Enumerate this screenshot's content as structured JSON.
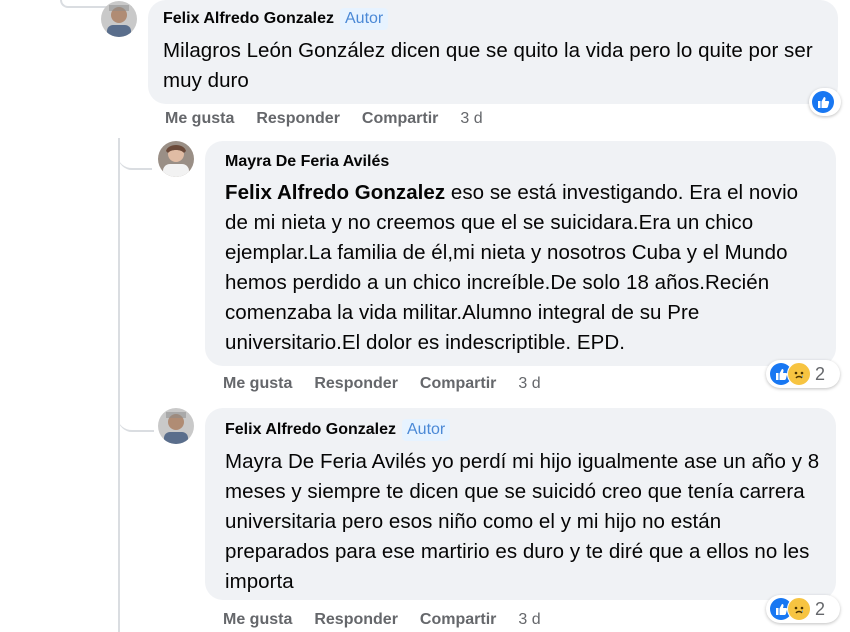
{
  "comments": [
    {
      "author": "Felix Alfredo Gonzalez",
      "badge": "Autor",
      "text": "Milagros León González dicen que se quito la vida pero lo quite por ser muy duro",
      "actions": {
        "like": "Me gusta",
        "reply": "Responder",
        "share": "Compartir",
        "time": "3 d"
      },
      "reactions": {
        "types": [
          "like-icon"
        ],
        "count": ""
      }
    },
    {
      "author": "Mayra De Feria Avilés",
      "mention": "Felix Alfredo Gonzalez",
      "text": " eso se está investigando. Era el novio de mi nieta y no creemos que el se suicidara.Era un chico ejemplar.La familia de él,mi nieta y nosotros Cuba y el Mundo hemos perdido a un chico increíble.De solo 18 años.Recién comenzaba la vida militar.Alumno integral de su Pre universitario.El dolor es indescriptible. EPD.",
      "actions": {
        "like": "Me gusta",
        "reply": "Responder",
        "share": "Compartir",
        "time": "3 d"
      },
      "reactions": {
        "types": [
          "like-icon",
          "sad-icon"
        ],
        "count": "2"
      }
    },
    {
      "author": "Felix Alfredo Gonzalez",
      "badge": "Autor",
      "text": "Mayra De Feria Avilés yo perdí mi hijo igualmente ase un año y 8 meses y siempre te dicen que se suicidó creo que tenía carrera universitaria pero esos niño como el y mi hijo no están preparados para ese martirio es duro y te diré que a ellos no les importa",
      "actions": {
        "like": "Me gusta",
        "reply": "Responder",
        "share": "Compartir",
        "time": "3 d"
      },
      "reactions": {
        "types": [
          "like-icon",
          "sad-icon"
        ],
        "count": "2"
      }
    }
  ],
  "colors": {
    "bubble": "#f0f2f5",
    "badge_bg": "#e7f3ff",
    "badge_text": "#4b89d6",
    "meta_text": "#65676b",
    "like_blue": "#1877f2",
    "sad_yellow": "#f7c441"
  }
}
